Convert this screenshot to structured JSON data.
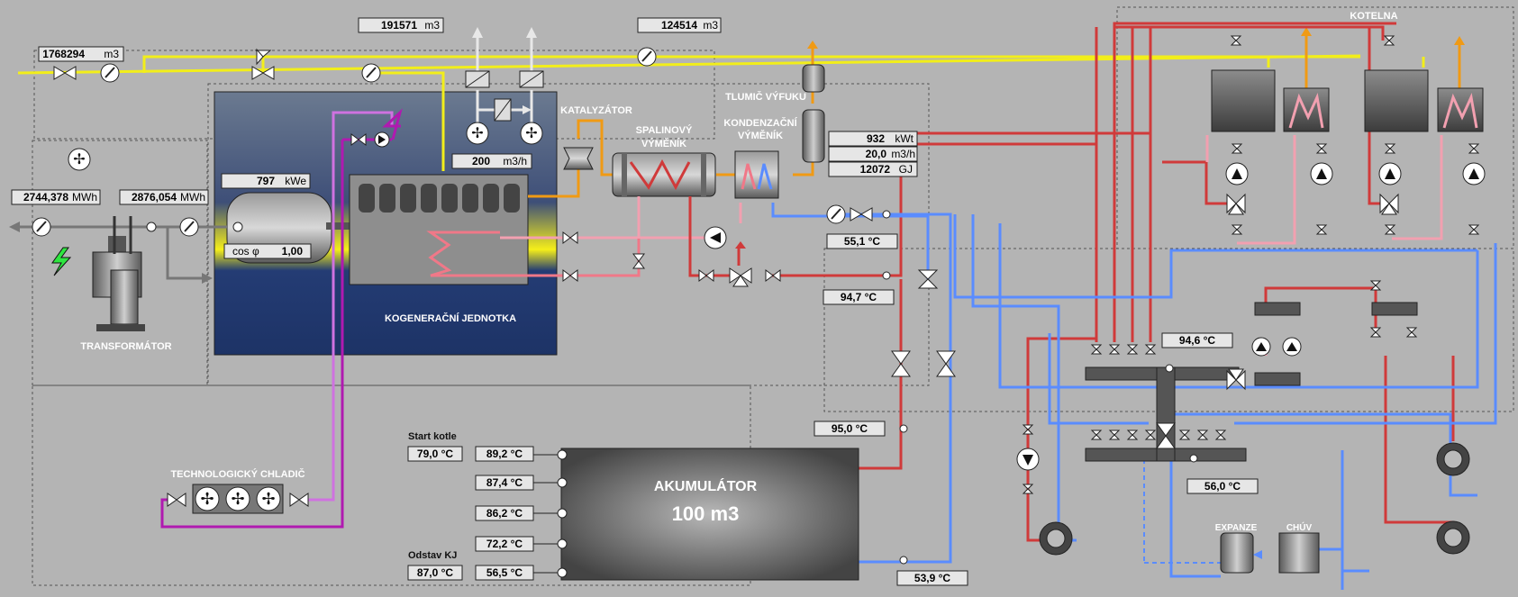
{
  "colors": {
    "background": "#b4b4b4",
    "gas": "#f2ee1a",
    "hot_water": "#d03a3a",
    "cold_water": "#5a8cff",
    "exhaust": "#f09a14",
    "cooling_circuit": "#b01ab0",
    "electricity": "#777777"
  },
  "labels": {
    "kotelna": "KOTELNA",
    "katalyzator": "KATALYZÁTOR",
    "tlumic": "TLUMIČ VÝFUKU",
    "spalinovy_1": "SPALINOVÝ",
    "spalinovy_2": "VÝMĚNÍK",
    "kondenzacni_1": "KONDENZAČNÍ",
    "kondenzacni_2": "VÝMĚNÍK",
    "kogeneracni": "KOGENERAČNÍ JEDNOTKA",
    "transformator": "TRANSFORMÁTOR",
    "chladic": "TECHNOLOGICKÝ CHLADIČ",
    "start_kotle": "Start kotle",
    "odstav_kj": "Odstav KJ",
    "akumulator": "AKUMULÁTOR",
    "akumulator_vol": "100 m3",
    "expanze": "EXPANZE",
    "chuv": "CHÚV",
    "cos_phi": "cos φ"
  },
  "meters": {
    "gas_total": {
      "value": "1768294",
      "unit": "m3"
    },
    "gas_kgj": {
      "value": "191571",
      "unit": "m3"
    },
    "gas_kotelna": {
      "value": "124514",
      "unit": "m3"
    },
    "elec_out": {
      "value": "2744,378",
      "unit": "MWh"
    },
    "elec_gen": {
      "value": "2876,054",
      "unit": "MWh"
    },
    "gas_flow": {
      "value": "200",
      "unit": "m3/h"
    },
    "power_el": {
      "value": "797",
      "unit": "kWe"
    },
    "cos_phi": {
      "value": "1,00"
    },
    "heat_power": {
      "value": "932",
      "unit": "kWt"
    },
    "heat_flow": {
      "value": "20,0",
      "unit": "m3/h"
    },
    "heat_energy": {
      "value": "12072",
      "unit": "GJ"
    }
  },
  "temperatures": {
    "t_return_kgj": "55,1 °C",
    "t_supply_kgj": "94,7 °C",
    "t_acc_top": "95,0 °C",
    "t_acc_bottom": "53,9 °C",
    "t_dist_supply": "94,6 °C",
    "t_dist_return": "56,0 °C",
    "start_kotle": "79,0 °C",
    "odstav_kj": "87,0 °C",
    "acc_1": "89,2 °C",
    "acc_2": "87,4 °C",
    "acc_3": "86,2 °C",
    "acc_4": "72,2 °C",
    "acc_5": "56,5 °C"
  }
}
